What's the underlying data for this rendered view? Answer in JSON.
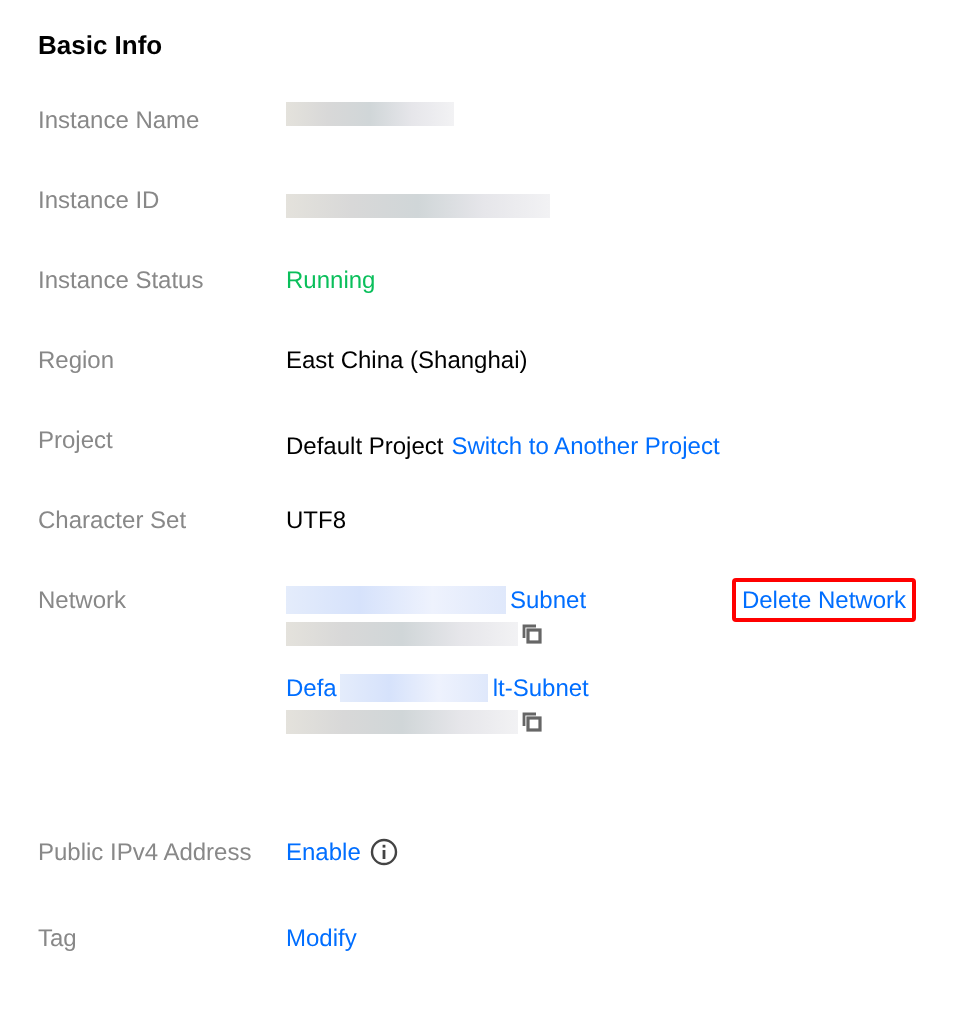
{
  "section": {
    "title": "Basic Info"
  },
  "rows": [
    {
      "label": "Instance Name",
      "kind": "redacted"
    },
    {
      "label": "Instance ID",
      "kind": "redacted2"
    },
    {
      "label": "Instance Status",
      "kind": "status",
      "value": "Running"
    },
    {
      "label": "Region",
      "kind": "text",
      "value": "East China (Shanghai)"
    },
    {
      "label": "Project",
      "kind": "project",
      "value": "Default Project",
      "link": "Switch to Another Project"
    },
    {
      "label": "Character Set",
      "kind": "text",
      "value": "UTF8"
    },
    {
      "label": "Network",
      "kind": "network",
      "networks": [
        {
          "after": "Subnet"
        },
        {
          "before": "Defa",
          "after": "lt-Subnet"
        }
      ],
      "action": {
        "label": "Delete Network",
        "highlighted": true
      }
    },
    {
      "label": "Public IPv4 Address",
      "kind": "enable",
      "link": "Enable"
    },
    {
      "label": "Tag",
      "kind": "link",
      "link": "Modify"
    }
  ]
}
